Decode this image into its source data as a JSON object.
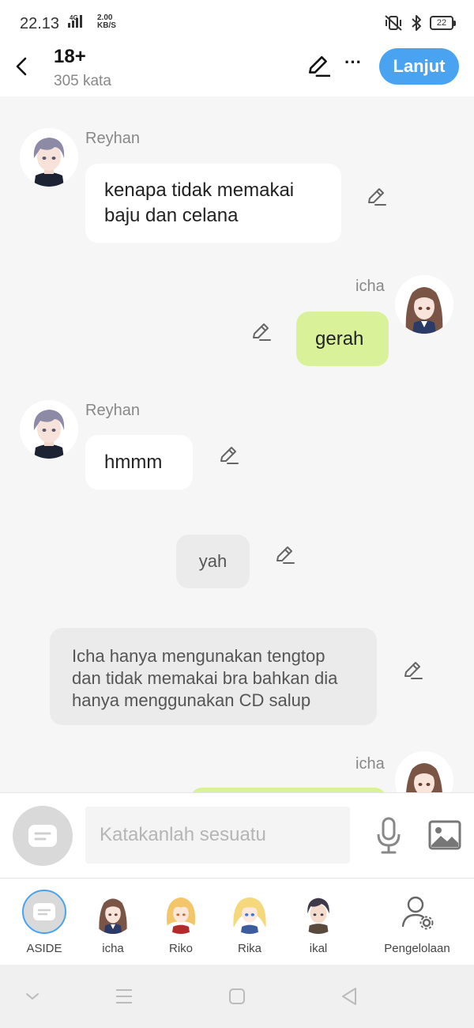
{
  "status": {
    "time": "22.13",
    "network": "4G",
    "speed_top": "2.00",
    "speed_unit": "KB/S",
    "battery": "22"
  },
  "header": {
    "title": "18+",
    "word_count": "305 kata",
    "continue_label": "Lanjut"
  },
  "messages": [
    {
      "sender": "Reyhan",
      "text_line1": "kenapa tidak memakai",
      "text_line2": "baju dan celana"
    },
    {
      "sender": "icha",
      "text": "gerah"
    },
    {
      "sender": "Reyhan",
      "text": "hmmm"
    },
    {
      "text": "yah"
    },
    {
      "text_line1": "Icha hanya mengunakan tengtop",
      "text_line2": "dan tidak memakai bra bahkan dia",
      "text_line3": "hanya menggunakan CD salup"
    },
    {
      "sender": "icha"
    }
  ],
  "composer": {
    "placeholder": "Katakanlah sesuatu"
  },
  "characters": [
    {
      "label": "ASIDE"
    },
    {
      "label": "icha"
    },
    {
      "label": "Riko"
    },
    {
      "label": "Rika"
    },
    {
      "label": "ikal"
    },
    {
      "label": "Pengelolaan"
    }
  ],
  "colors": {
    "accent": "#4aa3f0",
    "user_bubble": "#d9f29a",
    "background": "#f6f6f6"
  }
}
